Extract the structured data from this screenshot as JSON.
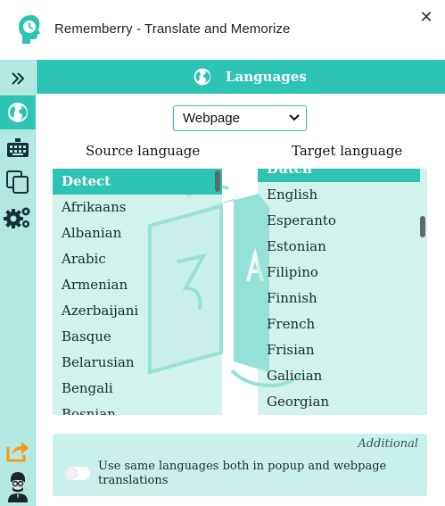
{
  "window": {
    "title": "Rememberry - Translate and Memorize",
    "close_glyph": "✕"
  },
  "sidebar": {
    "items": [
      {
        "icon": "double-chevron-right-icon",
        "active": false
      },
      {
        "icon": "globe-icon",
        "active": true
      },
      {
        "icon": "keyboard-icon",
        "active": false
      },
      {
        "icon": "copy-icon",
        "active": false
      },
      {
        "icon": "gears-icon",
        "active": false
      },
      {
        "icon": "share-icon",
        "active": false
      },
      {
        "icon": "user-avatar-icon",
        "active": false
      }
    ]
  },
  "header": {
    "title": "Languages",
    "icon": "globe-icon"
  },
  "mode_select": {
    "value": "Webpage",
    "icon": "chevron-down-icon"
  },
  "source": {
    "label": "Source language",
    "items": [
      "Detect",
      "Afrikaans",
      "Albanian",
      "Arabic",
      "Armenian",
      "Azerbaijani",
      "Basque",
      "Belarusian",
      "Bengali",
      "Bosnian"
    ],
    "selected": "Detect"
  },
  "target": {
    "label": "Target language",
    "items": [
      "Dutch",
      "English",
      "Esperanto",
      "Estonian",
      "Filipino",
      "Finnish",
      "French",
      "Frisian",
      "Galician",
      "Georgian"
    ],
    "selected": "Dutch"
  },
  "additional": {
    "label": "Additional",
    "toggle_label": "Use same languages both in popup and webpage translations",
    "toggle_on": false
  },
  "colors": {
    "accent": "#2ec4b3",
    "sidebar": "#b4e9e2",
    "list_bg": "#c5ede7",
    "panel_bg": "#c9f0eb"
  }
}
